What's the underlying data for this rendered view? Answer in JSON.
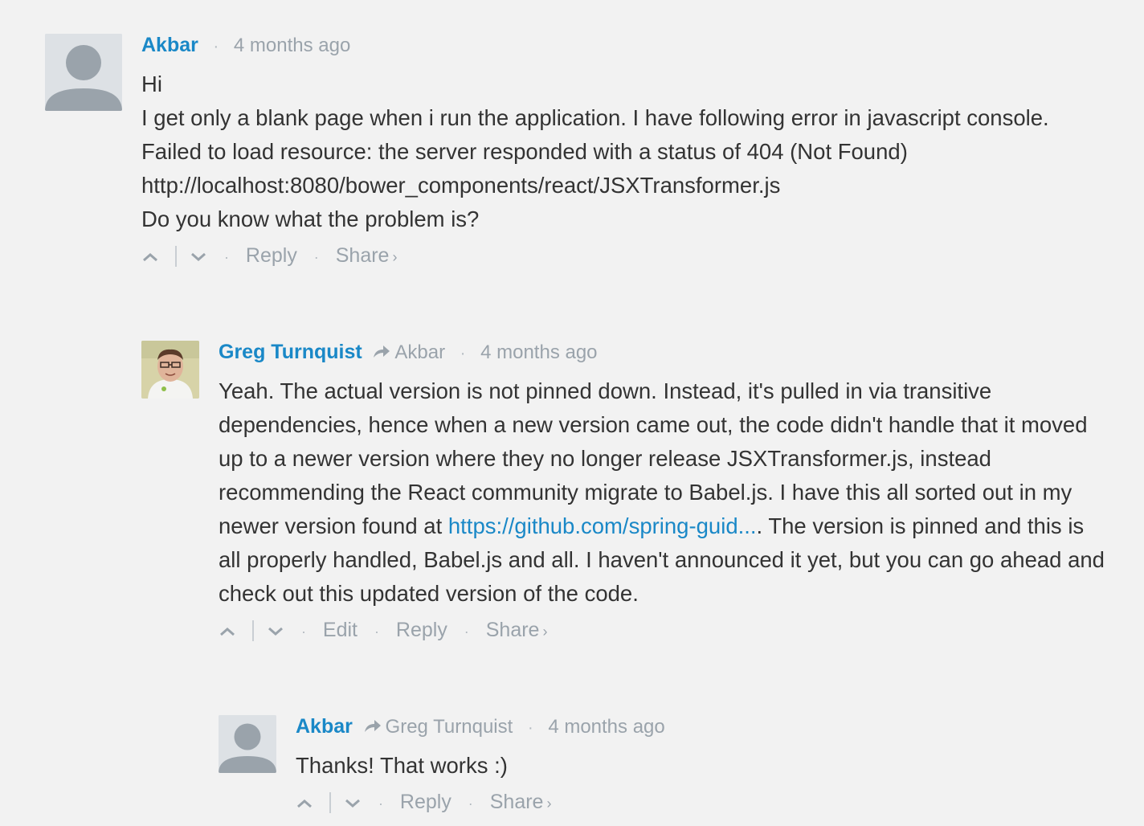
{
  "comments": [
    {
      "author": "Akbar",
      "reply_to": "",
      "time": "4 months ago",
      "lines": [
        "Hi",
        "I get only a blank page when i run the application. I have following error in javascript console.",
        "Failed to load resource: the server responded with a status of 404 (Not Found)",
        "http://localhost:8080/bower_components/react/JSXTransformer.js",
        "Do you know what the problem is?"
      ],
      "actions": {
        "reply": "Reply",
        "share": "Share"
      }
    },
    {
      "author": "Greg Turnquist",
      "reply_to": "Akbar",
      "time": "4 months ago",
      "text_before_link": "Yeah. The actual version is not pinned down. Instead, it's pulled in via transitive dependencies, hence when a new version came out, the code didn't handle that it moved up to a newer version where they no longer release JSXTransformer.js, instead recommending the React community migrate to Babel.js. I have this all sorted out in my newer version found at ",
      "link_text": "https://github.com/spring-guid...",
      "text_after_link": ". The version is pinned and this is all properly handled, Babel.js and all. I haven't announced it yet, but you can go ahead and check out this updated version of the code.",
      "actions": {
        "edit": "Edit",
        "reply": "Reply",
        "share": "Share"
      }
    },
    {
      "author": "Akbar",
      "reply_to": "Greg Turnquist",
      "time": "4 months ago",
      "lines": [
        "Thanks! That works :)"
      ],
      "actions": {
        "reply": "Reply",
        "share": "Share"
      }
    }
  ],
  "icons": {
    "upvote": "chevron-up-icon",
    "downvote": "chevron-down-icon",
    "reply_arrow": "reply-arrow-icon",
    "share_chevron": "chevron-right-icon"
  },
  "colors": {
    "background": "#f2f2f2",
    "author": "#1a88c7",
    "meta": "#9aa3ab",
    "text": "#333333"
  }
}
